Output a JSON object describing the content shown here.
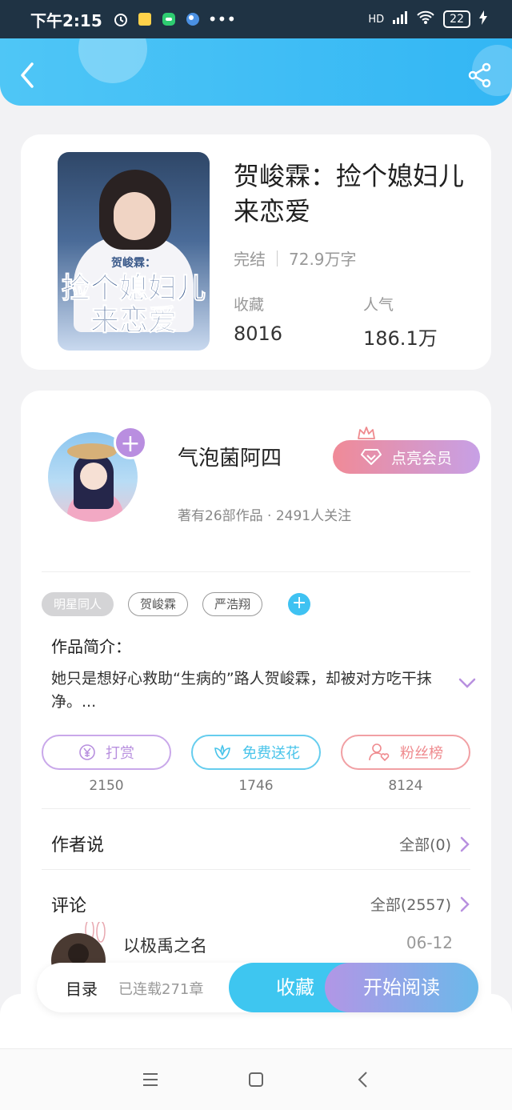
{
  "status_bar": {
    "time": "下午2:15",
    "more": "•••",
    "network": "HD",
    "battery": "22"
  },
  "book": {
    "title": "贺峻霖：捡个媳妇儿来恋爱",
    "status": "完结",
    "word_count": "72.9万字",
    "favorites_label": "收藏",
    "favorites_value": "8016",
    "popularity_label": "人气",
    "popularity_value": "186.1万",
    "cover_text_small": "贺峻霖：",
    "cover_text_big": "捡个媳妇儿来恋爱"
  },
  "author": {
    "name": "气泡菌阿四",
    "stats": "著有26部作品 · 2491人关注",
    "vip_label": "点亮会员"
  },
  "tags": [
    "明星同人",
    "贺峻霖",
    "严浩翔"
  ],
  "intro": {
    "label": "作品简介：",
    "text": "她只是想好心救助“生病的”路人贺峻霖，却被对方吃干抹净。..."
  },
  "actions": [
    {
      "label": "打赏",
      "count": "2150",
      "color": "#b890df"
    },
    {
      "label": "免费送花",
      "count": "1746",
      "color": "#49c4ea"
    },
    {
      "label": "粉丝榜",
      "count": "8124",
      "color": "#ef8a8e"
    }
  ],
  "author_says": {
    "title": "作者说",
    "link": "全部(0)"
  },
  "comments": {
    "title": "评论",
    "link": "全部(2557)",
    "first_user": "以极禹之名",
    "first_date": "06-12"
  },
  "bottom_bar": {
    "toc": "目录",
    "serial": "已连载271章",
    "collect": "收藏",
    "read": "开始阅读"
  },
  "colors": {
    "accent": "#3ec6f0",
    "purple": "#b98ee0"
  }
}
